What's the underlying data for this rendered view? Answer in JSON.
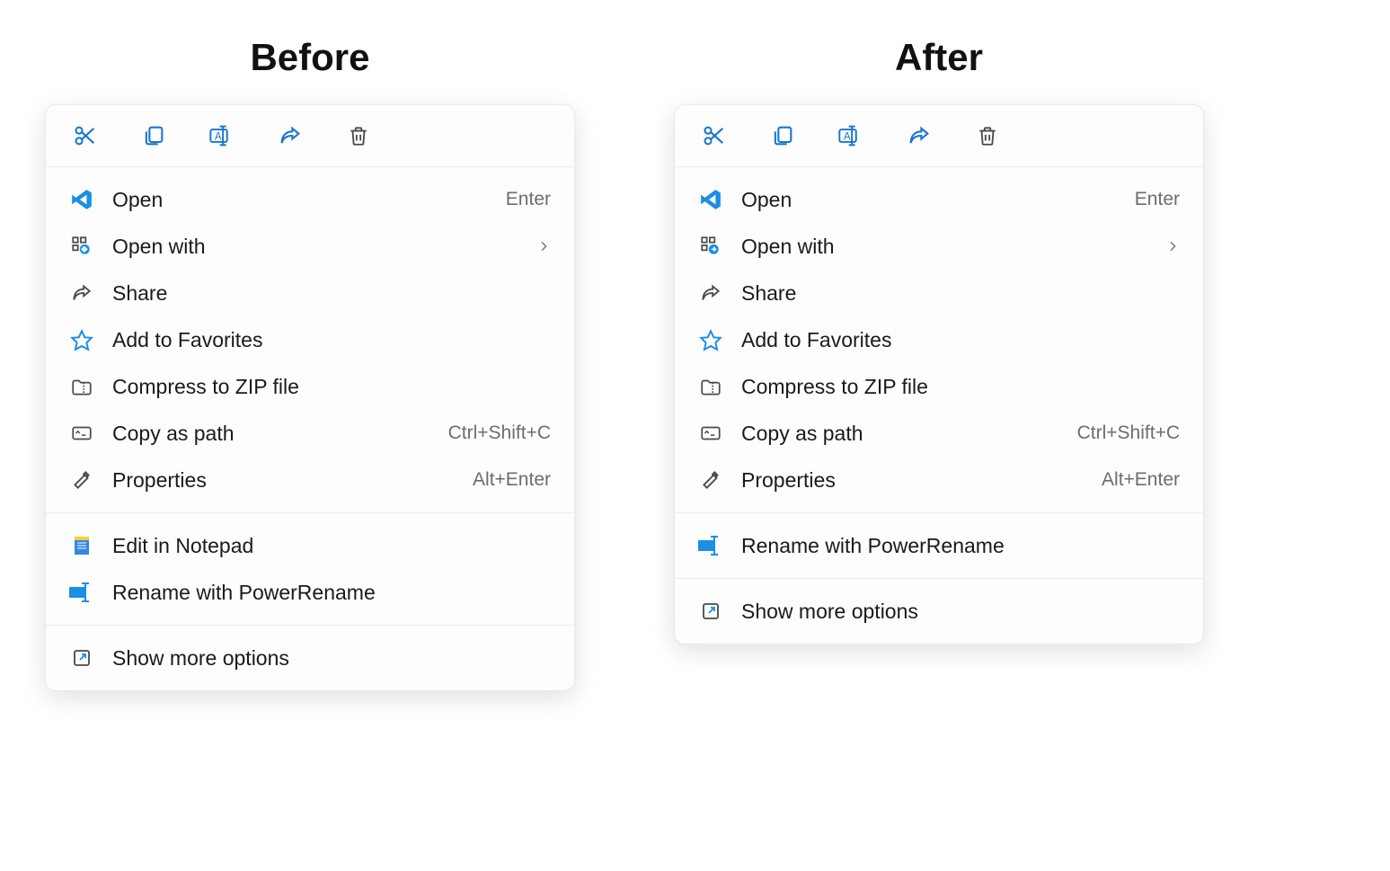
{
  "headings": {
    "before": "Before",
    "after": "After"
  },
  "colors": {
    "accent": "#1a73e8",
    "dark": "#4a4a4a",
    "muted": "#6d6d6d"
  },
  "items": {
    "open": {
      "label": "Open",
      "shortcut": "Enter"
    },
    "open_with": {
      "label": "Open with"
    },
    "share": {
      "label": "Share"
    },
    "favorites": {
      "label": "Add to Favorites"
    },
    "compress": {
      "label": "Compress to ZIP file"
    },
    "copy_path": {
      "label": "Copy as path",
      "shortcut": "Ctrl+Shift+C"
    },
    "properties": {
      "label": "Properties",
      "shortcut": "Alt+Enter"
    },
    "edit_np": {
      "label": "Edit in Notepad"
    },
    "powerrename": {
      "label": "Rename with PowerRename"
    },
    "more": {
      "label": "Show more options"
    }
  }
}
